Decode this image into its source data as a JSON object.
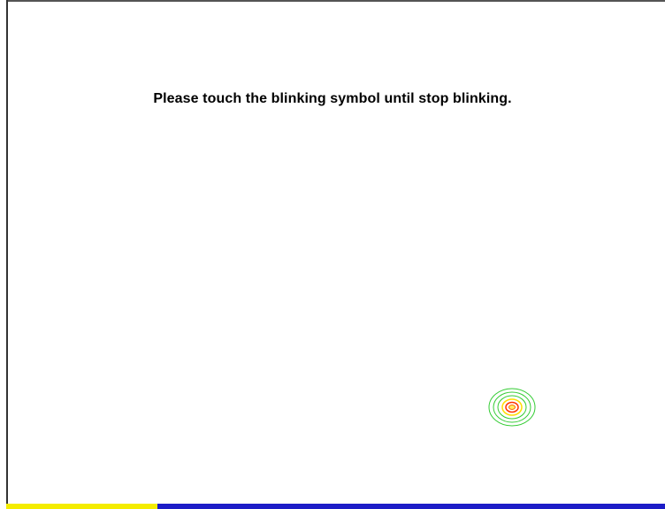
{
  "screen": {
    "instruction": "Please touch the blinking symbol until stop blinking."
  },
  "target": {
    "icon": "calibration-target-icon",
    "ring_colors": [
      "#33cc33",
      "#ff3300",
      "#ffee00"
    ]
  },
  "progress": {
    "fraction": 0.23,
    "fill_color": "#f4ec00",
    "track_color": "#1c1cc7"
  }
}
